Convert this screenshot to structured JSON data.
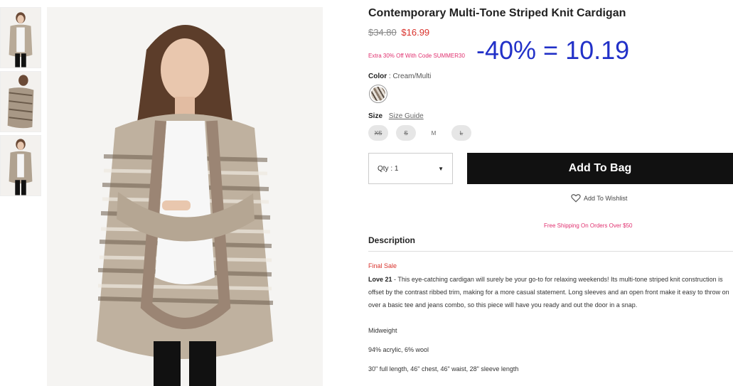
{
  "product": {
    "title": "Contemporary Multi-Tone Striped Knit Cardigan",
    "price_old": "$34.80",
    "price_new": "$16.99",
    "promo": "Extra 30% Off With Code SUMMER30",
    "annotation": "-40% = 10.19"
  },
  "color": {
    "label": "Color",
    "separator": ":",
    "value": "Cream/Multi"
  },
  "size": {
    "label": "Size",
    "guide": "Size Guide",
    "options": [
      {
        "label": "XS",
        "available": false
      },
      {
        "label": "S",
        "available": false
      },
      {
        "label": "M",
        "available": true
      },
      {
        "label": "L",
        "available": false
      }
    ]
  },
  "qty": {
    "label": "Qty : 1"
  },
  "actions": {
    "add_to_bag": "Add To Bag",
    "wishlist": "Add To Wishlist",
    "shipping": "Free Shipping On Orders Over $50"
  },
  "description": {
    "heading": "Description",
    "final_sale": "Final Sale",
    "brand": "Love 21",
    "text": " - This eye-catching cardigan will surely be your go-to for relaxing weekends! Its multi-tone striped knit construction is offset by the contrast ribbed trim, making for a more casual statement. Long sleeves and an open front make it easy to throw on over a basic tee and jeans combo, so this piece will have you ready and out the door in a snap.",
    "specs": [
      "Midweight",
      "94% acrylic, 6% wool",
      "30\" full length, 46\" chest, 46\" waist, 28\" sleeve length"
    ]
  },
  "colors": {
    "accent_pink": "#e0306f",
    "sale_red": "#d9322c",
    "annotation_blue": "#2231c8",
    "button_black": "#111111"
  }
}
